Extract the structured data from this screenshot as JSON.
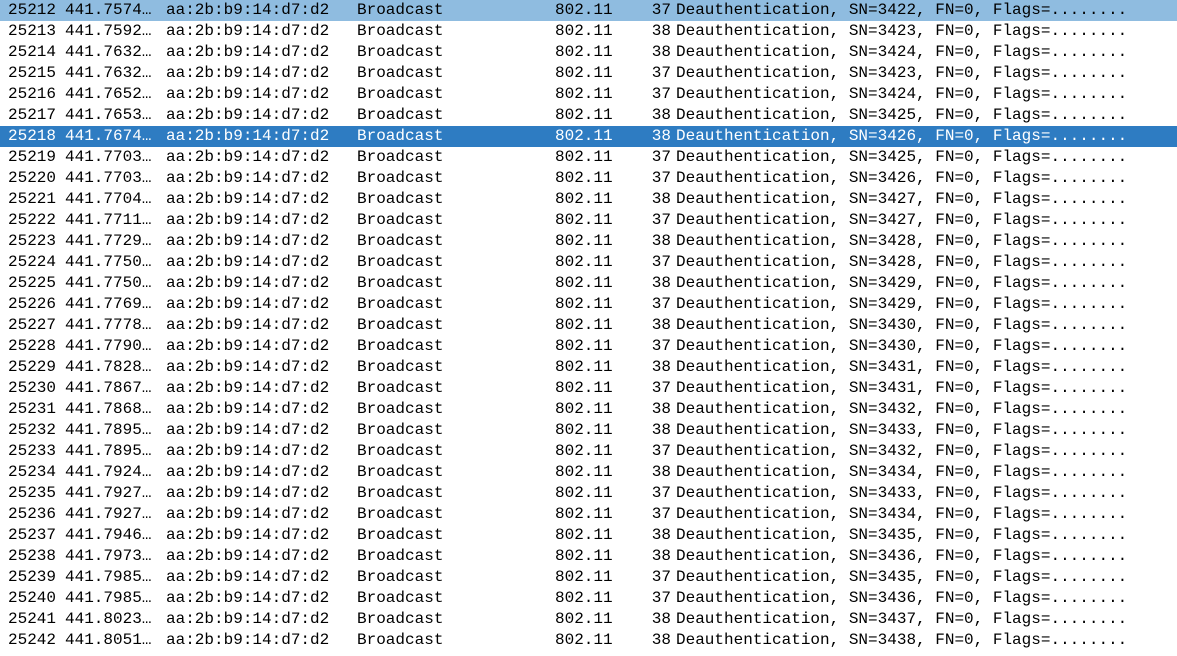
{
  "packets": [
    {
      "no": "25212",
      "time": "441.7574…",
      "source": "aa:2b:b9:14:d7:d2",
      "destination": "Broadcast",
      "protocol": "802.11",
      "length": "37",
      "info": "Deauthentication, SN=3422, FN=0, Flags=........",
      "state": "marked"
    },
    {
      "no": "25213",
      "time": "441.7592…",
      "source": "aa:2b:b9:14:d7:d2",
      "destination": "Broadcast",
      "protocol": "802.11",
      "length": "38",
      "info": "Deauthentication, SN=3423, FN=0, Flags=........",
      "state": ""
    },
    {
      "no": "25214",
      "time": "441.7632…",
      "source": "aa:2b:b9:14:d7:d2",
      "destination": "Broadcast",
      "protocol": "802.11",
      "length": "38",
      "info": "Deauthentication, SN=3424, FN=0, Flags=........",
      "state": ""
    },
    {
      "no": "25215",
      "time": "441.7632…",
      "source": "aa:2b:b9:14:d7:d2",
      "destination": "Broadcast",
      "protocol": "802.11",
      "length": "37",
      "info": "Deauthentication, SN=3423, FN=0, Flags=........",
      "state": ""
    },
    {
      "no": "25216",
      "time": "441.7652…",
      "source": "aa:2b:b9:14:d7:d2",
      "destination": "Broadcast",
      "protocol": "802.11",
      "length": "37",
      "info": "Deauthentication, SN=3424, FN=0, Flags=........",
      "state": ""
    },
    {
      "no": "25217",
      "time": "441.7653…",
      "source": "aa:2b:b9:14:d7:d2",
      "destination": "Broadcast",
      "protocol": "802.11",
      "length": "38",
      "info": "Deauthentication, SN=3425, FN=0, Flags=........",
      "state": ""
    },
    {
      "no": "25218",
      "time": "441.7674…",
      "source": "aa:2b:b9:14:d7:d2",
      "destination": "Broadcast",
      "protocol": "802.11",
      "length": "38",
      "info": "Deauthentication, SN=3426, FN=0, Flags=........",
      "state": "selected"
    },
    {
      "no": "25219",
      "time": "441.7703…",
      "source": "aa:2b:b9:14:d7:d2",
      "destination": "Broadcast",
      "protocol": "802.11",
      "length": "37",
      "info": "Deauthentication, SN=3425, FN=0, Flags=........",
      "state": ""
    },
    {
      "no": "25220",
      "time": "441.7703…",
      "source": "aa:2b:b9:14:d7:d2",
      "destination": "Broadcast",
      "protocol": "802.11",
      "length": "37",
      "info": "Deauthentication, SN=3426, FN=0, Flags=........",
      "state": ""
    },
    {
      "no": "25221",
      "time": "441.7704…",
      "source": "aa:2b:b9:14:d7:d2",
      "destination": "Broadcast",
      "protocol": "802.11",
      "length": "38",
      "info": "Deauthentication, SN=3427, FN=0, Flags=........",
      "state": ""
    },
    {
      "no": "25222",
      "time": "441.7711…",
      "source": "aa:2b:b9:14:d7:d2",
      "destination": "Broadcast",
      "protocol": "802.11",
      "length": "37",
      "info": "Deauthentication, SN=3427, FN=0, Flags=........",
      "state": ""
    },
    {
      "no": "25223",
      "time": "441.7729…",
      "source": "aa:2b:b9:14:d7:d2",
      "destination": "Broadcast",
      "protocol": "802.11",
      "length": "38",
      "info": "Deauthentication, SN=3428, FN=0, Flags=........",
      "state": ""
    },
    {
      "no": "25224",
      "time": "441.7750…",
      "source": "aa:2b:b9:14:d7:d2",
      "destination": "Broadcast",
      "protocol": "802.11",
      "length": "37",
      "info": "Deauthentication, SN=3428, FN=0, Flags=........",
      "state": ""
    },
    {
      "no": "25225",
      "time": "441.7750…",
      "source": "aa:2b:b9:14:d7:d2",
      "destination": "Broadcast",
      "protocol": "802.11",
      "length": "38",
      "info": "Deauthentication, SN=3429, FN=0, Flags=........",
      "state": ""
    },
    {
      "no": "25226",
      "time": "441.7769…",
      "source": "aa:2b:b9:14:d7:d2",
      "destination": "Broadcast",
      "protocol": "802.11",
      "length": "37",
      "info": "Deauthentication, SN=3429, FN=0, Flags=........",
      "state": ""
    },
    {
      "no": "25227",
      "time": "441.7778…",
      "source": "aa:2b:b9:14:d7:d2",
      "destination": "Broadcast",
      "protocol": "802.11",
      "length": "38",
      "info": "Deauthentication, SN=3430, FN=0, Flags=........",
      "state": ""
    },
    {
      "no": "25228",
      "time": "441.7790…",
      "source": "aa:2b:b9:14:d7:d2",
      "destination": "Broadcast",
      "protocol": "802.11",
      "length": "37",
      "info": "Deauthentication, SN=3430, FN=0, Flags=........",
      "state": ""
    },
    {
      "no": "25229",
      "time": "441.7828…",
      "source": "aa:2b:b9:14:d7:d2",
      "destination": "Broadcast",
      "protocol": "802.11",
      "length": "38",
      "info": "Deauthentication, SN=3431, FN=0, Flags=........",
      "state": ""
    },
    {
      "no": "25230",
      "time": "441.7867…",
      "source": "aa:2b:b9:14:d7:d2",
      "destination": "Broadcast",
      "protocol": "802.11",
      "length": "37",
      "info": "Deauthentication, SN=3431, FN=0, Flags=........",
      "state": ""
    },
    {
      "no": "25231",
      "time": "441.7868…",
      "source": "aa:2b:b9:14:d7:d2",
      "destination": "Broadcast",
      "protocol": "802.11",
      "length": "38",
      "info": "Deauthentication, SN=3432, FN=0, Flags=........",
      "state": ""
    },
    {
      "no": "25232",
      "time": "441.7895…",
      "source": "aa:2b:b9:14:d7:d2",
      "destination": "Broadcast",
      "protocol": "802.11",
      "length": "38",
      "info": "Deauthentication, SN=3433, FN=0, Flags=........",
      "state": ""
    },
    {
      "no": "25233",
      "time": "441.7895…",
      "source": "aa:2b:b9:14:d7:d2",
      "destination": "Broadcast",
      "protocol": "802.11",
      "length": "37",
      "info": "Deauthentication, SN=3432, FN=0, Flags=........",
      "state": ""
    },
    {
      "no": "25234",
      "time": "441.7924…",
      "source": "aa:2b:b9:14:d7:d2",
      "destination": "Broadcast",
      "protocol": "802.11",
      "length": "38",
      "info": "Deauthentication, SN=3434, FN=0, Flags=........",
      "state": ""
    },
    {
      "no": "25235",
      "time": "441.7927…",
      "source": "aa:2b:b9:14:d7:d2",
      "destination": "Broadcast",
      "protocol": "802.11",
      "length": "37",
      "info": "Deauthentication, SN=3433, FN=0, Flags=........",
      "state": ""
    },
    {
      "no": "25236",
      "time": "441.7927…",
      "source": "aa:2b:b9:14:d7:d2",
      "destination": "Broadcast",
      "protocol": "802.11",
      "length": "37",
      "info": "Deauthentication, SN=3434, FN=0, Flags=........",
      "state": ""
    },
    {
      "no": "25237",
      "time": "441.7946…",
      "source": "aa:2b:b9:14:d7:d2",
      "destination": "Broadcast",
      "protocol": "802.11",
      "length": "38",
      "info": "Deauthentication, SN=3435, FN=0, Flags=........",
      "state": ""
    },
    {
      "no": "25238",
      "time": "441.7973…",
      "source": "aa:2b:b9:14:d7:d2",
      "destination": "Broadcast",
      "protocol": "802.11",
      "length": "38",
      "info": "Deauthentication, SN=3436, FN=0, Flags=........",
      "state": ""
    },
    {
      "no": "25239",
      "time": "441.7985…",
      "source": "aa:2b:b9:14:d7:d2",
      "destination": "Broadcast",
      "protocol": "802.11",
      "length": "37",
      "info": "Deauthentication, SN=3435, FN=0, Flags=........",
      "state": ""
    },
    {
      "no": "25240",
      "time": "441.7985…",
      "source": "aa:2b:b9:14:d7:d2",
      "destination": "Broadcast",
      "protocol": "802.11",
      "length": "37",
      "info": "Deauthentication, SN=3436, FN=0, Flags=........",
      "state": ""
    },
    {
      "no": "25241",
      "time": "441.8023…",
      "source": "aa:2b:b9:14:d7:d2",
      "destination": "Broadcast",
      "protocol": "802.11",
      "length": "38",
      "info": "Deauthentication, SN=3437, FN=0, Flags=........",
      "state": ""
    },
    {
      "no": "25242",
      "time": "441.8051…",
      "source": "aa:2b:b9:14:d7:d2",
      "destination": "Broadcast",
      "protocol": "802.11",
      "length": "38",
      "info": "Deauthentication, SN=3438, FN=0, Flags=........",
      "state": ""
    }
  ]
}
